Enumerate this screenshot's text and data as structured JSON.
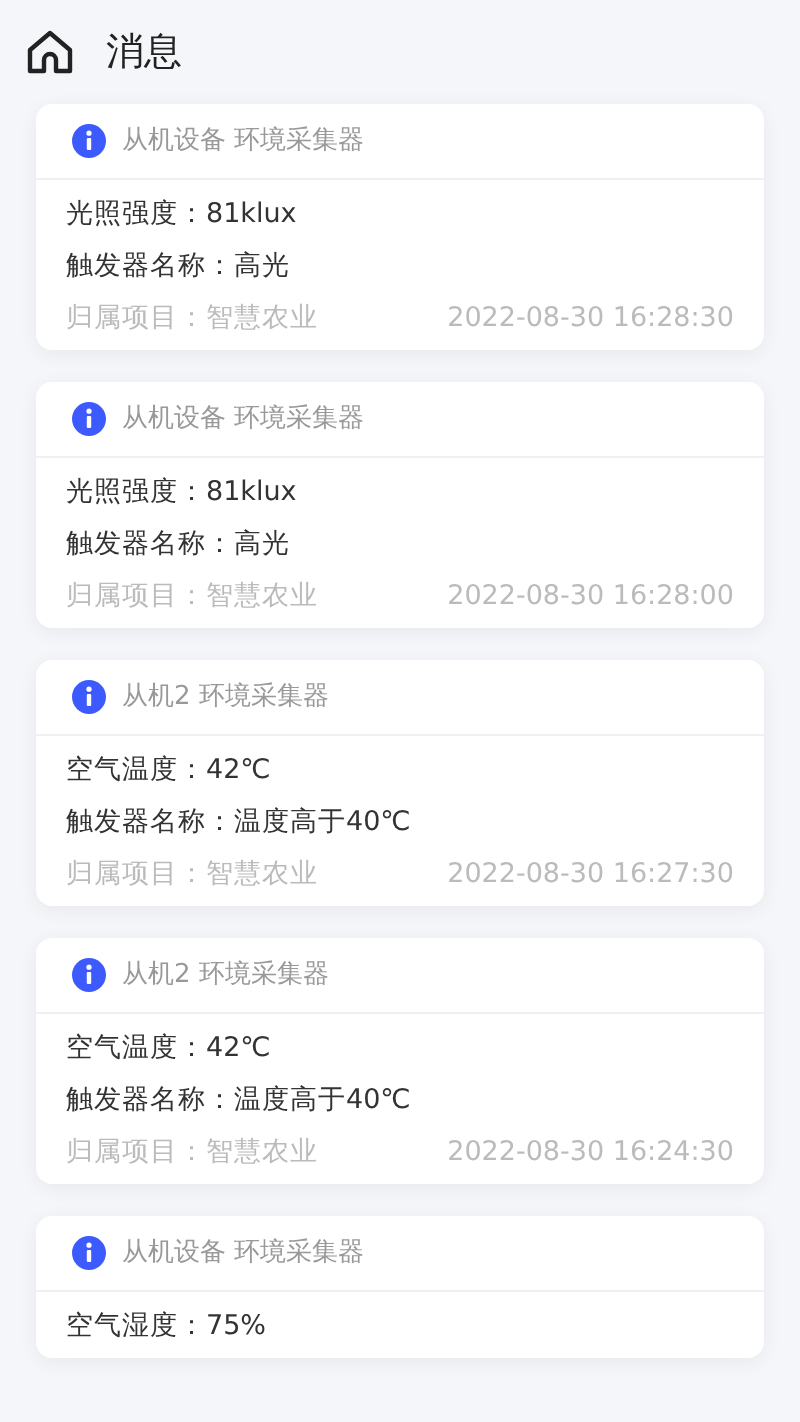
{
  "header": {
    "title": "消息"
  },
  "messages": [
    {
      "source": "从机设备 环境采集器",
      "lines": [
        "光照强度：81klux",
        "触发器名称：高光"
      ],
      "project": "归属项目：智慧农业",
      "time": "2022-08-30 16:28:30"
    },
    {
      "source": "从机设备 环境采集器",
      "lines": [
        "光照强度：81klux",
        "触发器名称：高光"
      ],
      "project": "归属项目：智慧农业",
      "time": "2022-08-30 16:28:00"
    },
    {
      "source": "从机2 环境采集器",
      "lines": [
        "空气温度：42℃",
        "触发器名称：温度高于40℃"
      ],
      "project": "归属项目：智慧农业",
      "time": "2022-08-30 16:27:30"
    },
    {
      "source": "从机2 环境采集器",
      "lines": [
        "空气温度：42℃",
        "触发器名称：温度高于40℃"
      ],
      "project": "归属项目：智慧农业",
      "time": "2022-08-30 16:24:30"
    },
    {
      "source": "从机设备 环境采集器",
      "lines": [
        "空气湿度：75%"
      ]
    }
  ]
}
